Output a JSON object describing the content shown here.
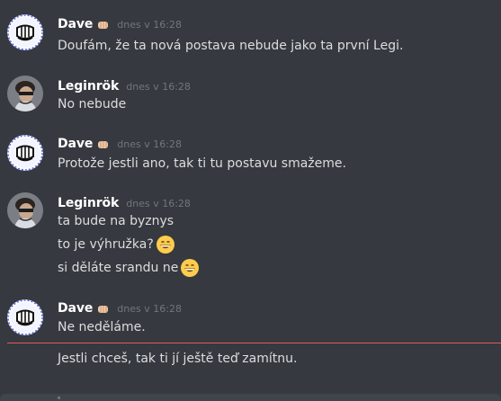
{
  "channel": {
    "messages": [
      {
        "author": "Dave",
        "badge": "fist-bump-emoji",
        "timestamp": "dnes v 16:28",
        "avatar": "dave-fist-avatar",
        "lines": [
          {
            "text": "Doufám, že ta nová postava nebude jako ta první Legi."
          }
        ]
      },
      {
        "author": "Leginrök",
        "timestamp": "dnes v 16:28",
        "avatar": "leginrok-photo-avatar",
        "lines": [
          {
            "text": "No nebude"
          }
        ]
      },
      {
        "author": "Dave",
        "badge": "fist-bump-emoji",
        "timestamp": "dnes v 16:28",
        "avatar": "dave-fist-avatar",
        "lines": [
          {
            "text": "Protože jestli ano, tak ti tu postavu smažeme."
          }
        ]
      },
      {
        "author": "Leginrök",
        "timestamp": "dnes v 16:28",
        "avatar": "leginrok-photo-avatar",
        "lines": [
          {
            "text": "ta bude na byznys"
          },
          {
            "text": "to je výhružka?",
            "emoji": "grinning-smile-emoji"
          },
          {
            "text": "si děláte srandu ne",
            "emoji": "grinning-smile-emoji"
          }
        ]
      },
      {
        "author": "Dave",
        "badge": "fist-bump-emoji",
        "timestamp": "dnes v 16:28",
        "avatar": "dave-fist-avatar",
        "lines": [
          {
            "text": "Ne neděláme."
          },
          {
            "text": "Jestli chceš, tak ti jí ještě teď zamítnu."
          }
        ]
      }
    ],
    "new_messages_divider_color": "#e0595d"
  },
  "colors": {
    "background": "#36393f",
    "username": "#ffffff",
    "message_text": "#dcddde",
    "timestamp": "#72767d"
  }
}
